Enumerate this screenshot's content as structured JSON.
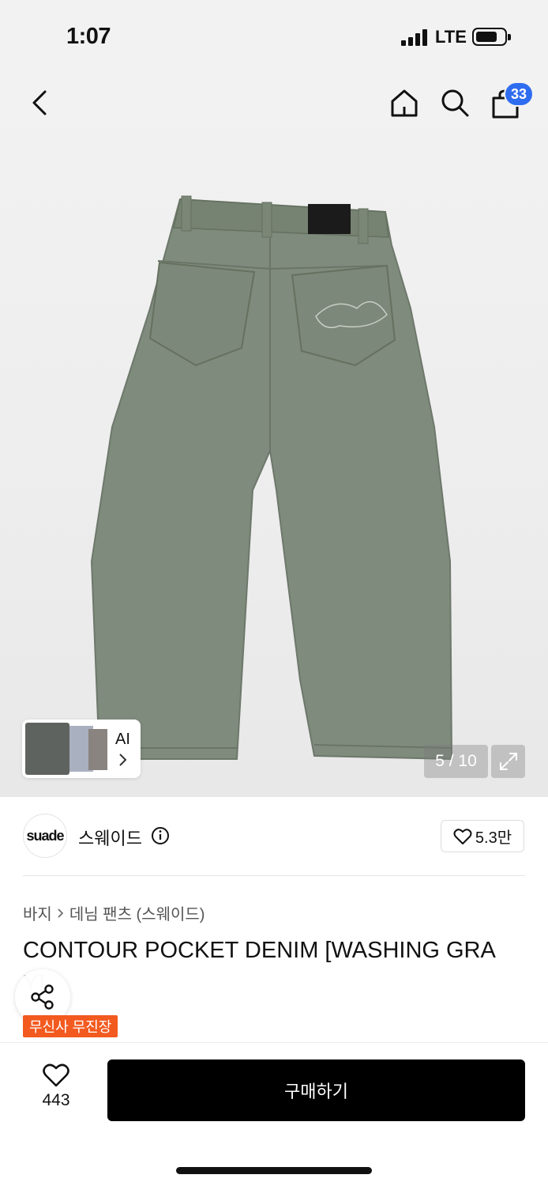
{
  "status": {
    "time": "1:07",
    "carrier": "LTE"
  },
  "nav": {
    "cart_count": "33"
  },
  "gallery": {
    "ai_label": "AI",
    "counter": "5 / 10"
  },
  "brand": {
    "logo_text": "suade",
    "name": "스웨이드",
    "likes": "5.3만"
  },
  "breadcrumb": {
    "category": "바지",
    "subcategory": "데님 팬츠 (스웨이드)"
  },
  "product": {
    "title": "CONTOUR POCKET DENIM [WASHING GRA",
    "title_cont": "Y]",
    "tag": "무신사 무진장"
  },
  "bottom": {
    "wish_count": "443",
    "buy_label": "구매하기"
  },
  "colors": {
    "accent_blue": "#2f6df0",
    "tag_orange": "#f35a1f",
    "denim": "#7f8b7d"
  }
}
